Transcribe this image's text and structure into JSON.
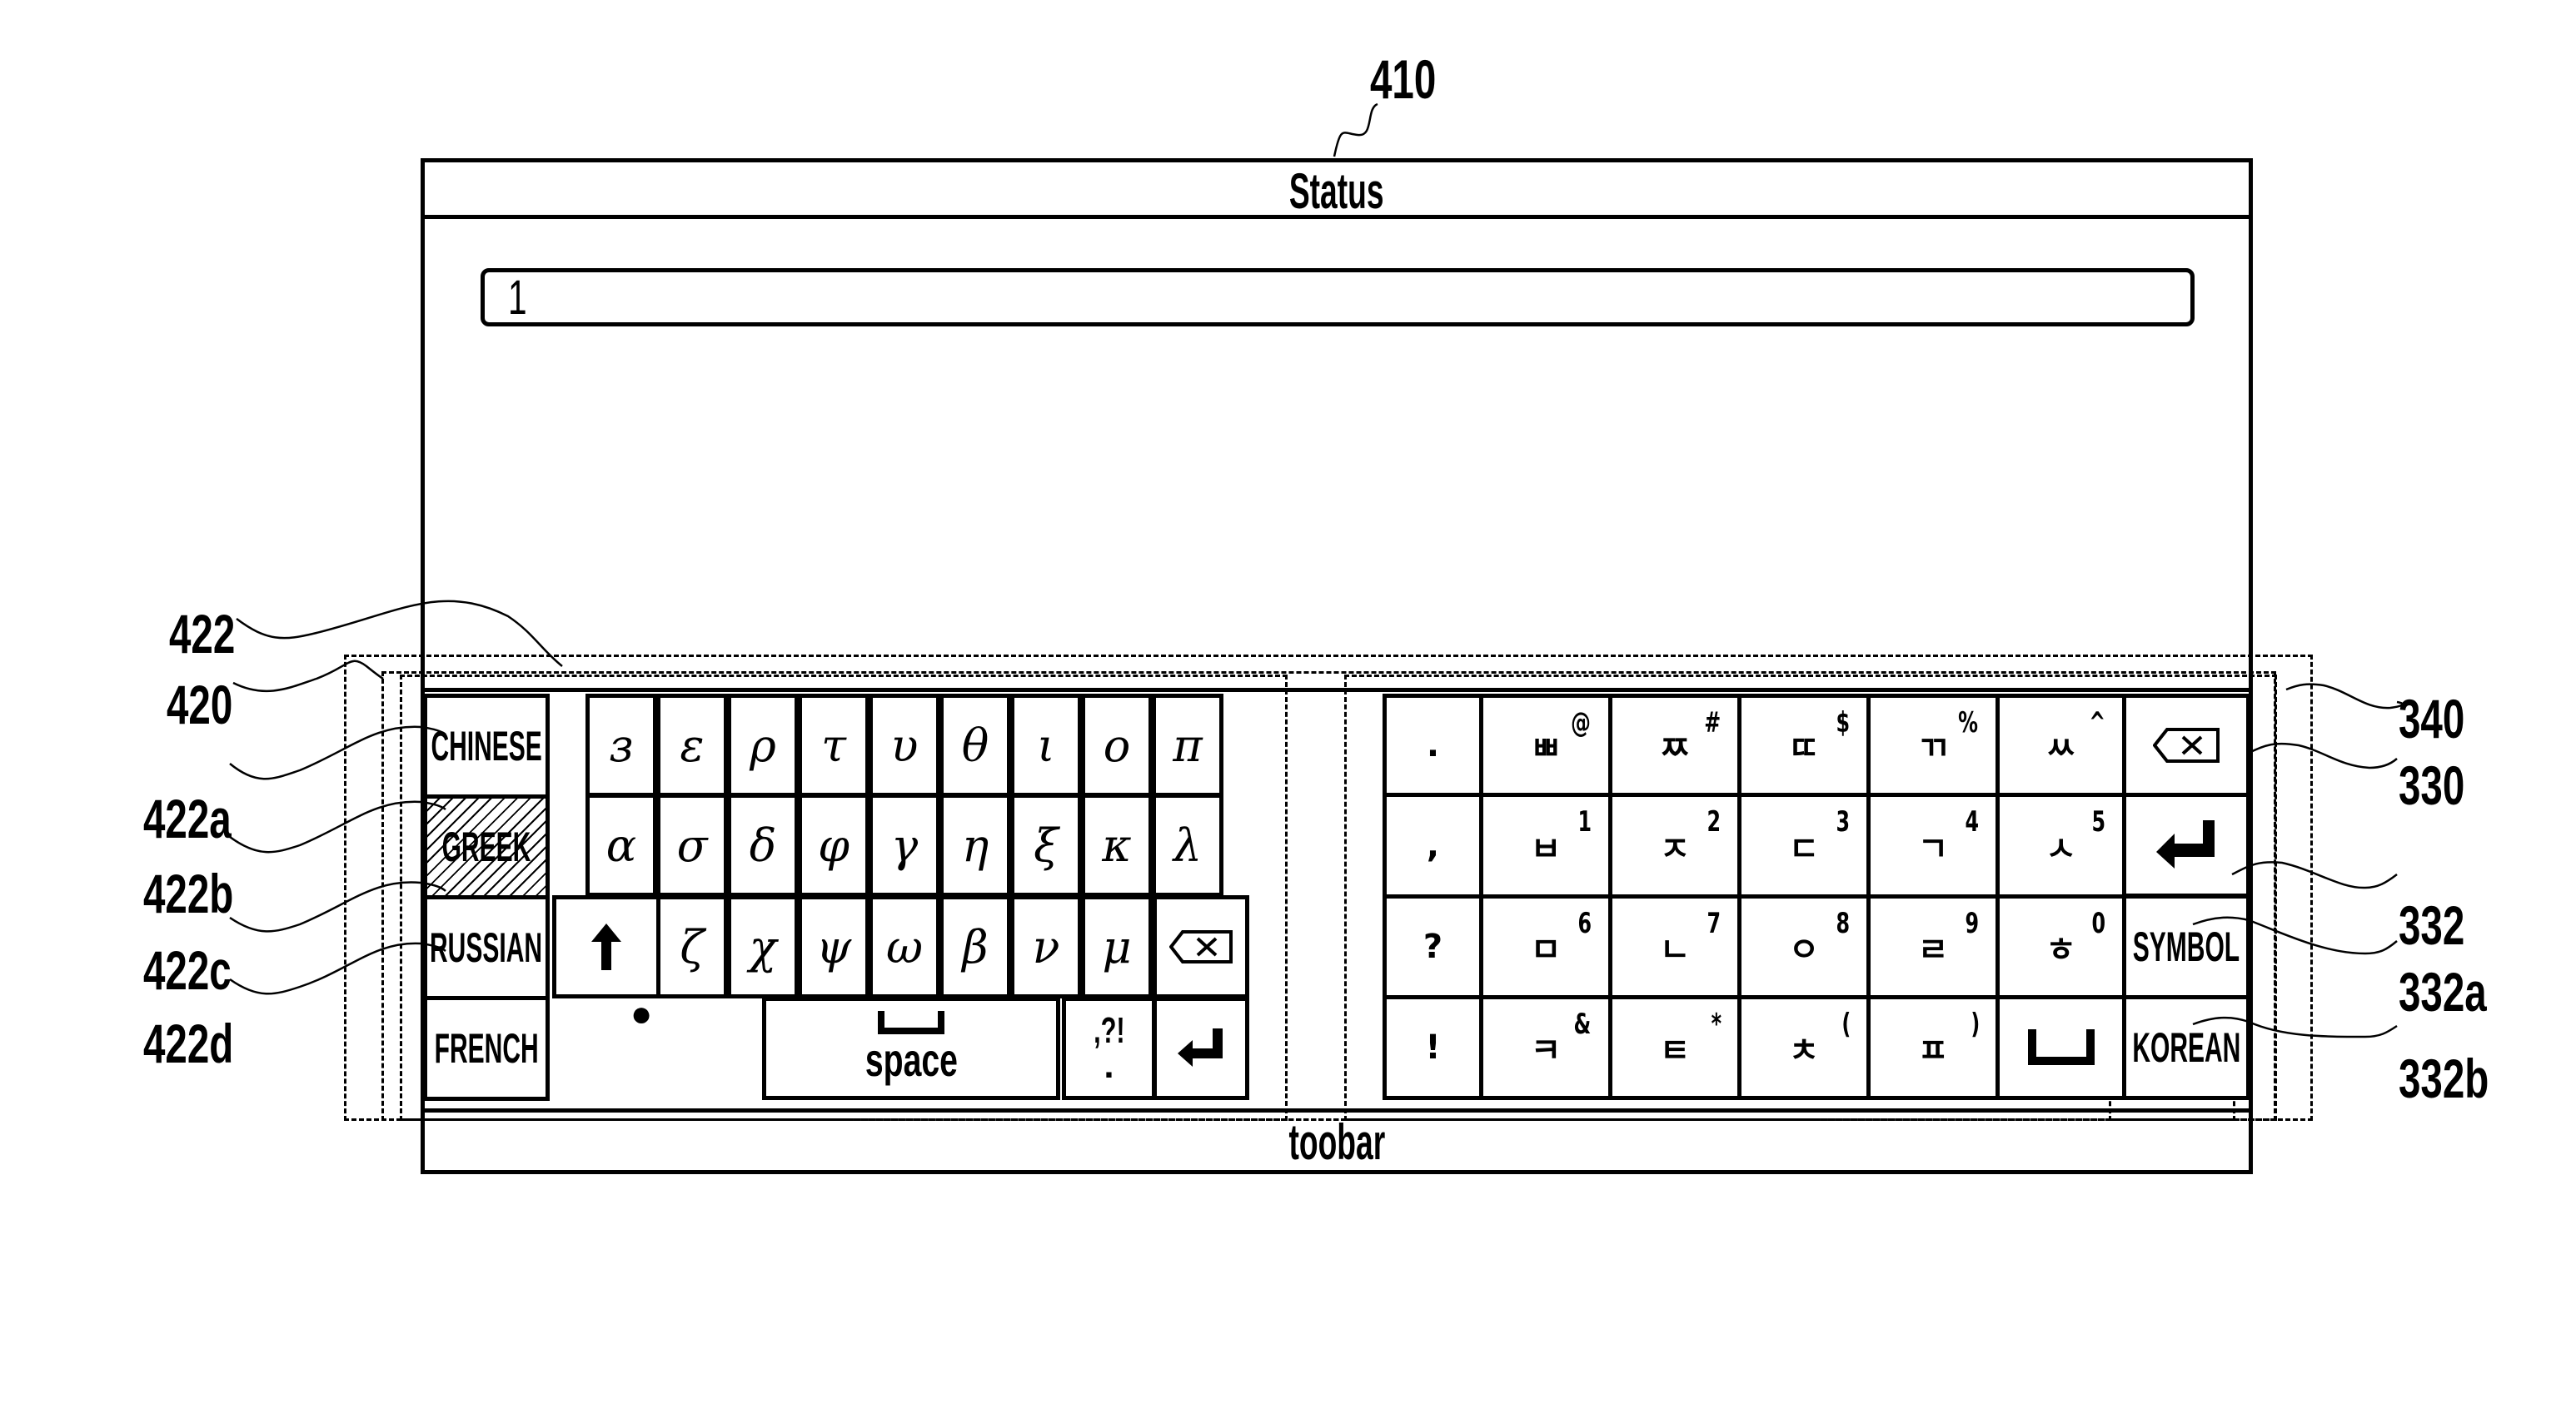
{
  "figure": {
    "ref_labels": {
      "device": "410",
      "left_keyboard_region": "420",
      "language_list": "422",
      "chinese_item": "422a",
      "greek_item": "422b",
      "russian_item": "422c",
      "french_item": "422d",
      "right_keyboard_region_outer": "340",
      "right_keyboard_region": "330",
      "mode_keys": "332",
      "symbol_key": "332a",
      "korean_key": "332b"
    }
  },
  "status_bar": {
    "title": "Status"
  },
  "input_field": {
    "value": "1"
  },
  "toolbar": {
    "label": "toobar"
  },
  "language_list": {
    "items": [
      {
        "label": "CHINESE",
        "selected": false
      },
      {
        "label": "GREEK",
        "selected": true
      },
      {
        "label": "RUSSIAN",
        "selected": false
      },
      {
        "label": "FRENCH",
        "selected": false
      }
    ]
  },
  "greek_keyboard": {
    "row1": [
      "з",
      "ε",
      "ρ",
      "τ",
      "υ",
      "θ",
      "ι",
      "ο",
      "π"
    ],
    "row2": [
      "α",
      "σ",
      "δ",
      "φ",
      "γ",
      "η",
      "ξ",
      "κ",
      "λ"
    ],
    "row3": [
      "ζ",
      "χ",
      "ψ",
      "ω",
      "β",
      "ν",
      "μ"
    ],
    "shift_icon": "shift-arrow-up-icon",
    "backspace_icon": "backspace-icon",
    "indicator_dot": "●",
    "space_label": "space",
    "space_icon": "space-bar-icon",
    "punct_label_top": ",?!",
    "punct_label_bottom": ".",
    "enter_icon": "enter-return-icon"
  },
  "korean_keyboard": {
    "rows": [
      [
        {
          "main": "."
        },
        {
          "main": "ㅃ",
          "sup": "@"
        },
        {
          "main": "ㅉ",
          "sup": "#"
        },
        {
          "main": "ㄸ",
          "sup": "$"
        },
        {
          "main": "ㄲ",
          "sup": "%"
        },
        {
          "main": "ㅆ",
          "sup": "^"
        }
      ],
      [
        {
          "main": ","
        },
        {
          "main": "ㅂ",
          "sup": "1"
        },
        {
          "main": "ㅈ",
          "sup": "2"
        },
        {
          "main": "ㄷ",
          "sup": "3"
        },
        {
          "main": "ㄱ",
          "sup": "4"
        },
        {
          "main": "ㅅ",
          "sup": "5"
        }
      ],
      [
        {
          "main": "?"
        },
        {
          "main": "ㅁ",
          "sup": "6"
        },
        {
          "main": "ㄴ",
          "sup": "7"
        },
        {
          "main": "ㅇ",
          "sup": "8"
        },
        {
          "main": "ㄹ",
          "sup": "9"
        },
        {
          "main": "ㅎ",
          "sup": "0"
        }
      ],
      [
        {
          "main": "!"
        },
        {
          "main": "ㅋ",
          "sup": "&"
        },
        {
          "main": "ㅌ",
          "sup": "*"
        },
        {
          "main": "ㅊ",
          "sup": "("
        },
        {
          "main": "ㅍ",
          "sup": ")"
        },
        {
          "main": ""
        }
      ]
    ],
    "backspace_icon": "backspace-icon",
    "enter_icon": "enter-return-icon",
    "space_icon": "space-bar-icon",
    "symbol_label": "SYMBOL",
    "korean_label": "KOREAN"
  }
}
